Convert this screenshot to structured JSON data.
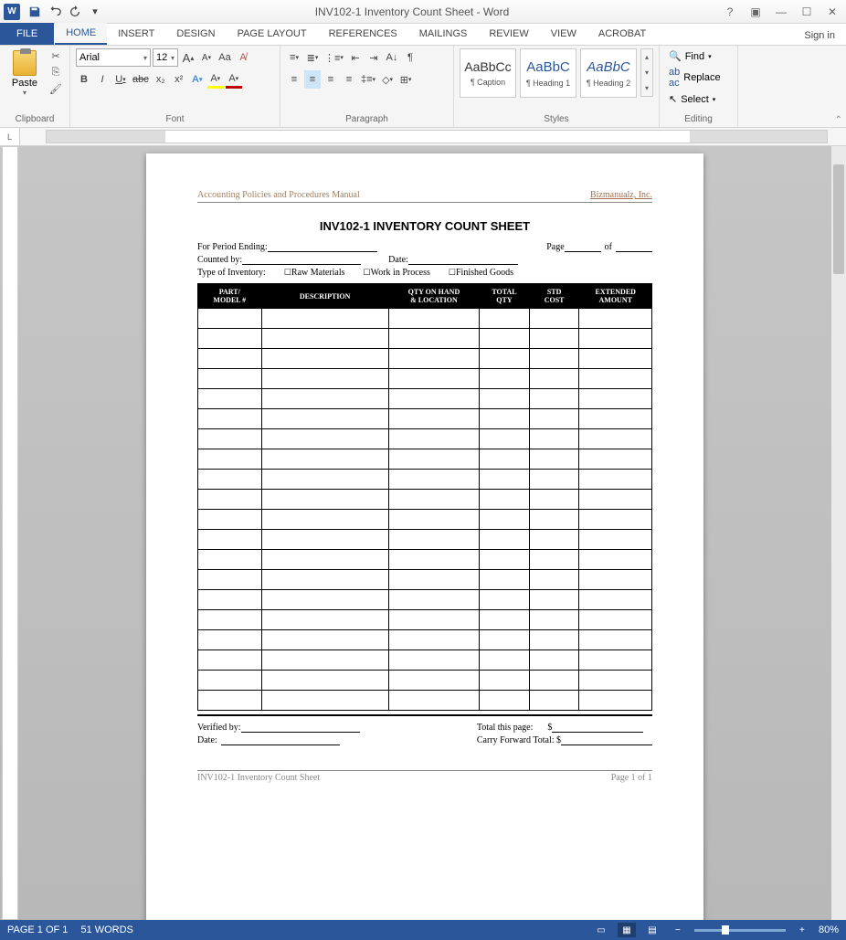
{
  "titlebar": {
    "title": "INV102-1 Inventory Count Sheet - Word",
    "help": "?",
    "signin": "Sign in"
  },
  "tabs": {
    "file": "FILE",
    "items": [
      "HOME",
      "INSERT",
      "DESIGN",
      "PAGE LAYOUT",
      "REFERENCES",
      "MAILINGS",
      "REVIEW",
      "VIEW",
      "ACROBAT"
    ],
    "active": 0
  },
  "ribbon": {
    "clipboard": {
      "label": "Clipboard",
      "paste": "Paste"
    },
    "font": {
      "label": "Font",
      "name": "Arial",
      "size": "12",
      "grow": "A",
      "shrink": "A",
      "case": "Aa",
      "bold": "B",
      "italic": "I",
      "underline": "U",
      "strike": "abc",
      "sub": "x₂",
      "sup": "x²",
      "hl": "A",
      "color": "A"
    },
    "paragraph": {
      "label": "Paragraph"
    },
    "styles": {
      "label": "Styles",
      "preview": "AaBbCc",
      "preview2": "AaBbC",
      "s1": "¶ Caption",
      "s2": "¶ Heading 1",
      "s3": "¶ Heading 2"
    },
    "editing": {
      "label": "Editing",
      "find": "Find",
      "replace": "Replace",
      "select": "Select"
    }
  },
  "document": {
    "hdr_left": "Accounting Policies and Procedures Manual",
    "hdr_right": "Bizmanualz, Inc.",
    "title": "INV102-1 INVENTORY COUNT SHEET",
    "period": "For Period Ending:",
    "page_lbl": "Page",
    "of": "of",
    "counted": "Counted by:",
    "date": "Date:",
    "type": "Type of Inventory:",
    "opt1": "Raw Materials",
    "opt2": "Work in Process",
    "opt3": "Finished Goods",
    "cols": [
      "PART/\nMODEL #",
      "DESCRIPTION",
      "QTY ON HAND\n& LOCATION",
      "TOTAL\nQTY",
      "STD\nCOST",
      "EXTENDED\nAMOUNT"
    ],
    "rows": 20,
    "verified": "Verified by:",
    "date2": "Date:",
    "total_page": "Total this page:",
    "carry": "Carry Forward Total: $",
    "dollar": "$",
    "ftr_left": "INV102-1 Inventory Count Sheet",
    "ftr_right": "Page 1 of 1"
  },
  "status": {
    "page": "PAGE 1 OF 1",
    "words": "51 WORDS",
    "zoom": "80%"
  }
}
